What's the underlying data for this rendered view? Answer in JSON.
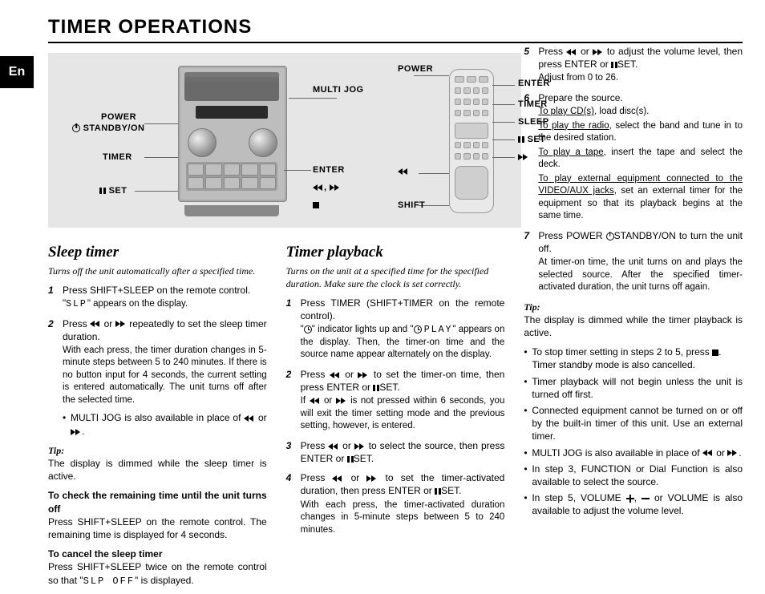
{
  "lang_tab": "En",
  "title": "TIMER OPERATIONS",
  "diagram": {
    "unit_labels": {
      "power": "POWER",
      "standby": "STANDBY/ON",
      "timer": "TIMER",
      "set": "SET",
      "multi_jog": "MULTI JOG",
      "enter": "ENTER"
    },
    "remote_labels": {
      "power": "POWER",
      "enter": "ENTER",
      "timer": "TIMER",
      "sleep": "SLEEP",
      "set": "SET",
      "shift": "SHIFT"
    }
  },
  "sleep": {
    "heading": "Sleep timer",
    "subtitle": "Turns off the unit automatically after a specified time.",
    "step1": "Press SHIFT+SLEEP on the remote control.",
    "step1_sub": "\" appears on the display.",
    "step1_slp": "SLP",
    "step2_a": "Press ",
    "step2_b": " repeatedly to set the sleep timer duration.",
    "step2_sub1": "With each press, the timer duration changes in 5-minute steps between 5 to 240 minutes. If there is no button input for 4 seconds, the current setting is entered automatically. The unit turns off after the selected time.",
    "step2_bullet": "MULTI JOG is also available in place of ",
    "tip_head": "Tip:",
    "tip_body": "The display is dimmed while the sleep timer is active.",
    "check_head": "To check the remaining time until the unit turns off",
    "check_body": "Press SHIFT+SLEEP on the remote control. The remaining time is displayed for 4 seconds.",
    "cancel_head": "To cancel the sleep timer",
    "cancel_body_a": "Press SHIFT+SLEEP twice on the remote control so that \"",
    "cancel_body_b": "\" is displayed.",
    "slp_off": "SLP OFF"
  },
  "playback": {
    "heading": "Timer playback",
    "subtitle": "Turns on the unit at a specified time for the specified duration. Make sure the clock is set correctly.",
    "step1": "Press TIMER (SHIFT+TIMER on the remote control).",
    "step1_sub_a": "\"",
    "step1_sub_b": "\" indicator lights up and \"",
    "step1_play": "PLAY",
    "step1_sub_c": "\" appears on the display. Then, the timer-on time and the source name appear alternately on the display.",
    "step2_a": "Press ",
    "step2_b": " to set the timer-on time, then press ENTER or ",
    "step2_c": "SET.",
    "step2_sub_a": "If ",
    "step2_sub_b": " is not pressed within 6 seconds, you will exit the timer setting mode and the previous setting, however, is entered.",
    "step3_a": "Press ",
    "step3_b": " to select the source, then press ENTER or ",
    "step3_c": "SET.",
    "step4_a": "Press ",
    "step4_b": " to set the timer-activated duration, then press ENTER or ",
    "step4_c": "SET.",
    "step4_sub": "With each press, the timer-activated duration changes in 5-minute steps between 5 to 240 minutes.",
    "step5_a": "Press ",
    "step5_b": " to adjust the volume level, then press ENTER or ",
    "step5_c": "SET.",
    "step5_sub": "Adjust from 0 to 26.",
    "step6": "Prepare the source.",
    "step6_cd_u": "To play CD(s)",
    "step6_cd": ", load disc(s).",
    "step6_radio_u": "To play the radio",
    "step6_radio": ", select the band and tune in to the desired station.",
    "step6_tape_u": "To play a tape",
    "step6_tape": ", insert the tape and select the deck.",
    "step6_ext_u": "To play external equipment connected to the VIDEO/AUX jacks",
    "step6_ext": ", set an external timer for the equipment so that its playback begins at the same time.",
    "step7_a": "Press POWER ",
    "step7_b": "STANDBY/ON to turn the unit off.",
    "step7_sub": "At timer-on time, the unit turns on and plays the selected source. After the specified timer-activated duration, the unit turns off again.",
    "tip_head": "Tip:",
    "tip1": "The display is dimmed while the timer playback is active.",
    "b1_a": "To stop timer setting in steps 2 to 5, press ",
    "b1_b": ".",
    "b1_c": "Timer standby mode is also cancelled.",
    "b2": "Timer playback will not begin unless the unit is turned off first.",
    "b3": "Connected equipment cannot be turned on or off by the built-in timer of this unit. Use an external timer.",
    "b4_a": "MULTI JOG is also available in place of ",
    "b4_b": ".",
    "b5": "In step 3, FUNCTION or Dial Function is also available to select the source.",
    "b6_a": "In step 5, VOLUME ",
    "b6_b": ", ",
    "b6_c": " or VOLUME is also available to adjust the volume level."
  },
  "glue": {
    "or": " or ",
    "comma": ", ",
    "period": "."
  }
}
